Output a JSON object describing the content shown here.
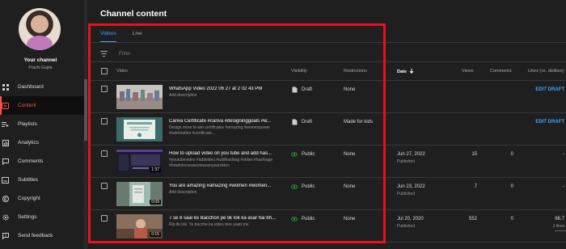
{
  "sidebar": {
    "channel_title": "Your channel",
    "channel_name": "Prachi Gupta",
    "items": [
      {
        "label": "Dashboard",
        "icon": "dashboard-icon",
        "active": false
      },
      {
        "label": "Content",
        "icon": "content-icon",
        "active": true
      },
      {
        "label": "Playlists",
        "icon": "playlists-icon",
        "active": false
      },
      {
        "label": "Analytics",
        "icon": "analytics-icon",
        "active": false
      },
      {
        "label": "Comments",
        "icon": "comments-icon",
        "active": false
      },
      {
        "label": "Subtitles",
        "icon": "subtitles-icon",
        "active": false
      },
      {
        "label": "Copyright",
        "icon": "copyright-icon",
        "active": false
      },
      {
        "label": "Settings",
        "icon": "settings-icon",
        "active": false
      },
      {
        "label": "Send feedback",
        "icon": "feedback-icon",
        "active": false
      }
    ]
  },
  "main": {
    "title": "Channel content",
    "tabs": [
      {
        "label": "Videos",
        "active": true
      },
      {
        "label": "Live",
        "active": false
      }
    ],
    "filter_placeholder": "Filter",
    "columns": {
      "video": "Video",
      "visibility": "Visibility",
      "restrictions": "Restrictions",
      "date": "Date",
      "views": "Views",
      "comments": "Comments",
      "likes": "Likes (vs. dislikes)"
    },
    "rows": [
      {
        "title": "WhatsApp Video 2022 06 27 at 2 02 43 PM",
        "description": "Add description",
        "duration": "",
        "visibility": "Draft",
        "visibility_icon": "draft-icon",
        "restrictions": "None",
        "date": "",
        "date_status": "",
        "views": "",
        "comments": "",
        "likes": "EDIT DRAFT",
        "likes_sub": ""
      },
      {
        "title": "Canva Certificate #canva #designinggoals #w...",
        "description": "Design more to win certificates #amazing #womenpower #celebration #certificate...",
        "duration": "",
        "visibility": "Draft",
        "visibility_icon": "draft-icon",
        "restrictions": "Made for kids",
        "date": "",
        "date_status": "",
        "views": "",
        "comments": "",
        "likes": "EDIT DRAFT",
        "likes_sub": ""
      },
      {
        "title": "How to upload video on you tube and add has...",
        "description": "#youtubevideo #addvideo #addhashtag #video #hashtage #howtoincreaseviewsonyourvideo",
        "duration": "1:37",
        "visibility": "Public",
        "visibility_icon": "eye-icon",
        "restrictions": "None",
        "date": "Jun 27, 2022",
        "date_status": "Published",
        "views": "15",
        "comments": "0",
        "likes": "-",
        "likes_sub": ""
      },
      {
        "title": "You are amazing #amazing #women #women...",
        "description": "Add description",
        "duration": "0:09",
        "visibility": "Public",
        "visibility_icon": "eye-icon",
        "restrictions": "None",
        "date": "Jun 23, 2022",
        "date_status": "Published",
        "views": "7",
        "comments": "0",
        "likes": "-",
        "likes_sub": ""
      },
      {
        "title": "7 se 8 saal ke Bacchon pe tik tok ka asar hai bh...",
        "description": "Rip tik tok. Ye bacche ka video tere yaad me",
        "duration": "0:15",
        "visibility": "Public",
        "visibility_icon": "eye-icon",
        "restrictions": "None",
        "date": "Jul 20, 2020",
        "date_status": "Published",
        "views": "552",
        "comments": "0",
        "likes": "66.7",
        "likes_sub": "2 likes"
      }
    ]
  },
  "colors": {
    "accent_blue": "#3ea6ff",
    "active_red": "#ff4e45",
    "highlight_red": "#e8111c",
    "public_green": "#2ba640"
  }
}
